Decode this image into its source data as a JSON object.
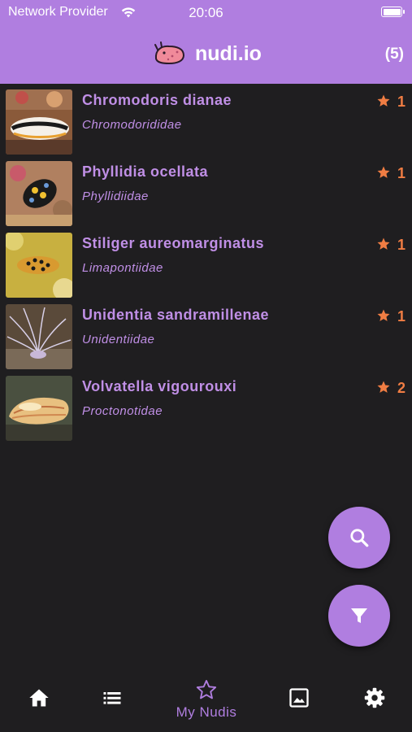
{
  "status_bar": {
    "carrier": "Network Provider",
    "time": "20:06"
  },
  "header": {
    "title": "nudi.io",
    "count": "(5)"
  },
  "colors": {
    "accent": "#b07ee0",
    "text_accent": "#c08fe6",
    "star": "#f07d43",
    "background": "#1f1e20"
  },
  "list": [
    {
      "name": "Chromodoris dianae",
      "family": "Chromodorididae",
      "rating": "1"
    },
    {
      "name": "Phyllidia ocellata",
      "family": "Phyllidiidae",
      "rating": "1"
    },
    {
      "name": "Stiliger aureomarginatus",
      "family": "Limapontiidae",
      "rating": "1"
    },
    {
      "name": "Unidentia sandramillenae",
      "family": "Unidentiidae",
      "rating": "1"
    },
    {
      "name": "Volvatella vigourouxi",
      "family": "Proctonotidae",
      "rating": "2"
    }
  ],
  "fabs": {
    "search_icon": "search-icon",
    "filter_icon": "filter-icon"
  },
  "bottom_nav": {
    "items": [
      {
        "icon": "home-icon"
      },
      {
        "icon": "list-icon"
      },
      {
        "icon": "star-outline-icon",
        "label": "My Nudis",
        "active": true
      },
      {
        "icon": "image-icon"
      },
      {
        "icon": "settings-icon"
      }
    ]
  }
}
